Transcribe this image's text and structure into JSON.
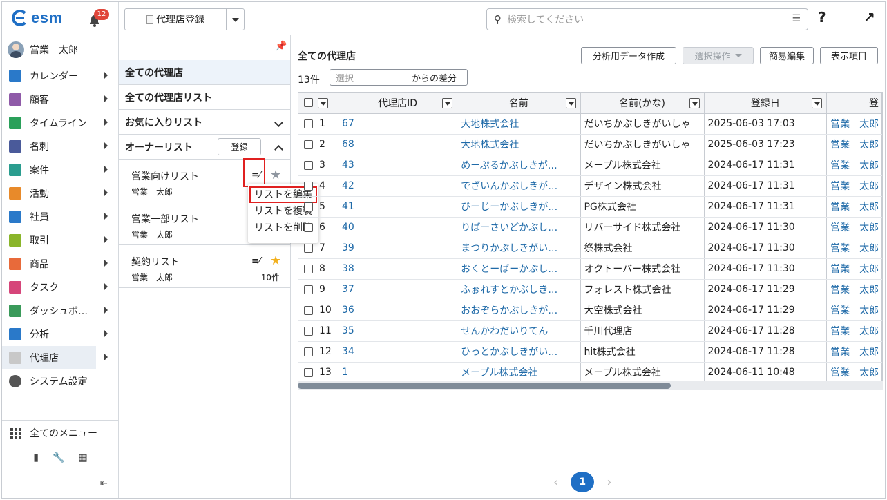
{
  "app": {
    "logo_text": "esm",
    "notification_count": "12"
  },
  "user": {
    "name": "営業　太郎"
  },
  "sidebar": {
    "items": [
      {
        "label": "カレンダー",
        "icon": "calendar-icon",
        "color": "#2a79c9"
      },
      {
        "label": "顧客",
        "icon": "building-icon",
        "color": "#8f5aa8"
      },
      {
        "label": "タイムライン",
        "icon": "chat-icon",
        "color": "#2aa05a"
      },
      {
        "label": "名刺",
        "icon": "card-icon",
        "color": "#4a5a9a"
      },
      {
        "label": "案件",
        "icon": "folder-icon",
        "color": "#2a9d8f"
      },
      {
        "label": "活動",
        "icon": "clipboard-icon",
        "color": "#e88a2a"
      },
      {
        "label": "社員",
        "icon": "person-icon",
        "color": "#2a79c9"
      },
      {
        "label": "取引",
        "icon": "note-icon",
        "color": "#8ab52a"
      },
      {
        "label": "商品",
        "icon": "box-icon",
        "color": "#e86a3a"
      },
      {
        "label": "タスク",
        "icon": "task-icon",
        "color": "#d6457a"
      },
      {
        "label": "ダッシュボ…",
        "icon": "dashboard-icon",
        "color": "#3a9a5a"
      },
      {
        "label": "分析",
        "icon": "chart-icon",
        "color": "#2a79c9"
      },
      {
        "label": "代理店",
        "icon": "document-icon",
        "color": "#c8c8c8"
      },
      {
        "label": "システム設定",
        "icon": "gear-icon",
        "color": "#555555"
      }
    ],
    "all_menu": "全てのメニュー"
  },
  "topbar": {
    "register_label": "代理店登録",
    "search_placeholder": "検索してください"
  },
  "listpanel": {
    "all_agencies": "全ての代理店",
    "all_lists": "全ての代理店リスト",
    "favorites": "お気に入りリスト",
    "owner_lists": "オーナーリスト",
    "register_btn": "登録",
    "lists": [
      {
        "title": "営業向けリスト",
        "owner": "営業　太郎",
        "count": "",
        "starred": false
      },
      {
        "title": "営業一部リスト",
        "owner": "営業　太郎",
        "count": "",
        "starred": false
      },
      {
        "title": "契約リスト",
        "owner": "営業　太郎",
        "count": "10件",
        "starred": true
      }
    ],
    "context_menu": [
      "リストを編集",
      "リストを複製",
      "リストを削除"
    ]
  },
  "main": {
    "title": "全ての代理店",
    "buttons": {
      "analysis": "分析用データ作成",
      "select_op": "選択操作",
      "quick_edit": "簡易編集",
      "display_items": "表示項目"
    },
    "count": "13件",
    "diff_placeholder": "選択",
    "diff_suffix": "からの差分",
    "columns": [
      "代理店ID",
      "名前",
      "名前(かな)",
      "登録日",
      "登"
    ],
    "rows": [
      {
        "n": "1",
        "id": "67",
        "name": "大地株式会社",
        "kana": "だいちかぶしきがいしゃ",
        "date": "2025-06-03 17:03",
        "owner": "営業　太郎"
      },
      {
        "n": "2",
        "id": "68",
        "name": "大地株式会社",
        "kana": "だいちかぶしきがいしゃ",
        "date": "2025-06-03 17:23",
        "owner": "営業　太郎"
      },
      {
        "n": "3",
        "id": "43",
        "name": "めーぷるかぶしきが…",
        "kana": "メープル株式会社",
        "date": "2024-06-17 11:31",
        "owner": "営業　太郎"
      },
      {
        "n": "4",
        "id": "42",
        "name": "でざいんかぶしきが…",
        "kana": "デザイン株式会社",
        "date": "2024-06-17 11:31",
        "owner": "営業　太郎"
      },
      {
        "n": "5",
        "id": "41",
        "name": "ぴーじーかぶしきが…",
        "kana": "PG株式会社",
        "date": "2024-06-17 11:31",
        "owner": "営業　太郎"
      },
      {
        "n": "6",
        "id": "40",
        "name": "りばーさいどかぶし…",
        "kana": "リバーサイド株式会社",
        "date": "2024-06-17 11:30",
        "owner": "営業　太郎"
      },
      {
        "n": "7",
        "id": "39",
        "name": "まつりかぶしきがい…",
        "kana": "祭株式会社",
        "date": "2024-06-17 11:30",
        "owner": "営業　太郎"
      },
      {
        "n": "8",
        "id": "38",
        "name": "おくとーばーかぶし…",
        "kana": "オクトーバー株式会社",
        "date": "2024-06-17 11:30",
        "owner": "営業　太郎"
      },
      {
        "n": "9",
        "id": "37",
        "name": "ふぉれすとかぶしき…",
        "kana": "フォレスト株式会社",
        "date": "2024-06-17 11:29",
        "owner": "営業　太郎"
      },
      {
        "n": "10",
        "id": "36",
        "name": "おおぞらかぶしきが…",
        "kana": "大空株式会社",
        "date": "2024-06-17 11:29",
        "owner": "営業　太郎"
      },
      {
        "n": "11",
        "id": "35",
        "name": "せんかわだいりてん",
        "kana": "千川代理店",
        "date": "2024-06-17 11:28",
        "owner": "営業　太郎"
      },
      {
        "n": "12",
        "id": "34",
        "name": "ひっとかぶしきがい…",
        "kana": "hit株式会社",
        "date": "2024-06-17 11:28",
        "owner": "営業　太郎"
      },
      {
        "n": "13",
        "id": "1",
        "name": "メープル株式会社",
        "kana": "メープル株式会社",
        "date": "2024-06-11 10:48",
        "owner": "営業　太郎"
      }
    ],
    "page": "1"
  }
}
